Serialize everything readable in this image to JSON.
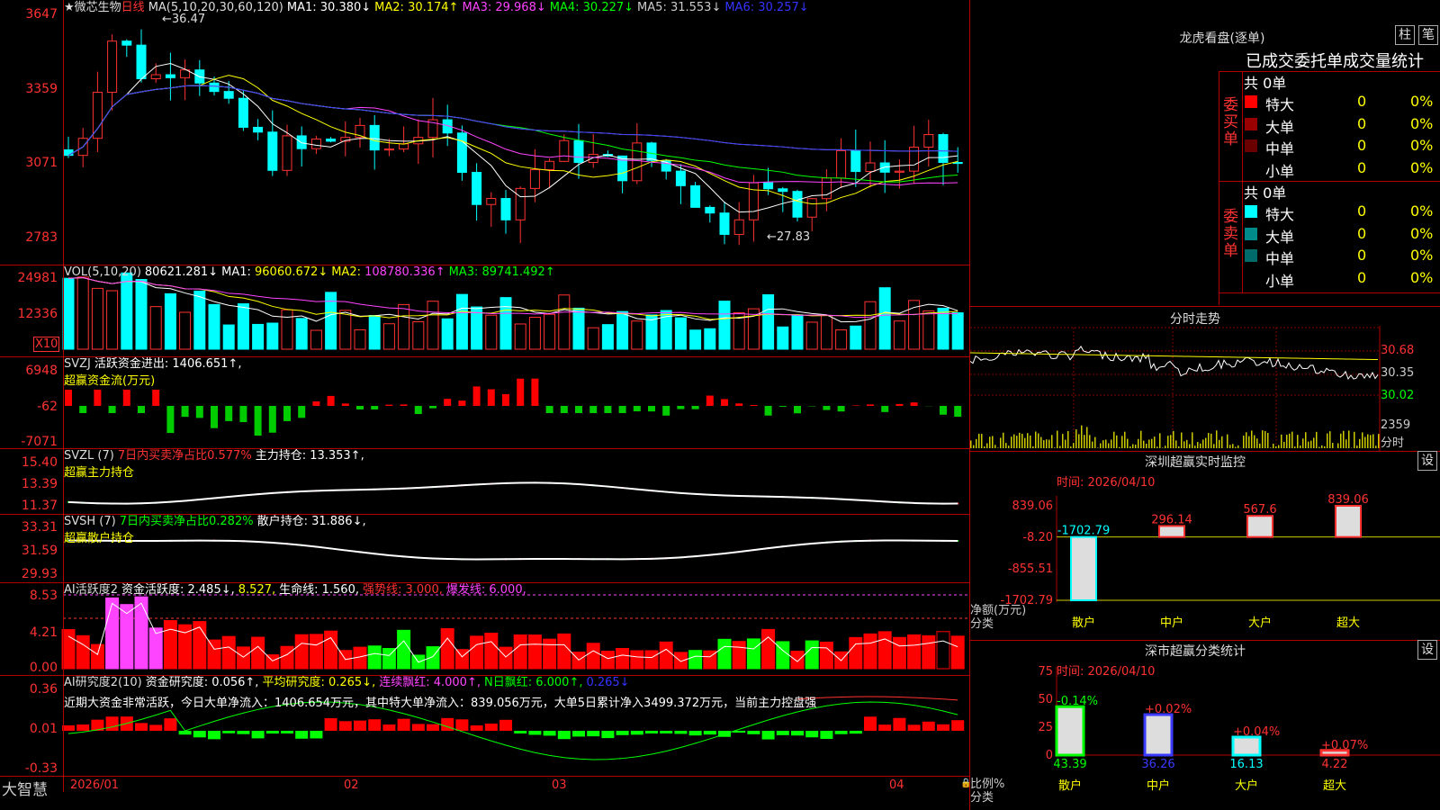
{
  "colors": {
    "up": "#ff3232",
    "down": "#00ffff",
    "ma1": "#ffffff",
    "ma2": "#ffff00",
    "ma3": "#ff44ff",
    "ma4": "#00ff00",
    "ma5": "#c8c8c8",
    "ma6": "#3a3aff"
  },
  "price": {
    "title": "微芯生物",
    "period": "日线",
    "ma_label": "MA(5,10,20,30,60,120)",
    "ma": [
      {
        "name": "MA1",
        "value": "30.380↓"
      },
      {
        "name": "MA2",
        "value": "30.174↑"
      },
      {
        "name": "MA3",
        "value": "29.968↓"
      },
      {
        "name": "MA4",
        "value": "30.227↓"
      },
      {
        "name": "MA5",
        "value": "31.553↓"
      },
      {
        "name": "MA6",
        "value": "30.257↓"
      }
    ],
    "yticks": [
      "3647",
      "3359",
      "3071",
      "2783"
    ],
    "high_label": "36.47",
    "low_label": "27.83"
  },
  "volume": {
    "label": "VOL(5,10,20)",
    "value": "80621.281↓",
    "ma1": "96060.672↓",
    "ma2": "108780.336↑",
    "ma3": "89741.492↑",
    "yticks": [
      "24981",
      "12336"
    ],
    "unit": "X10"
  },
  "svzj": {
    "label": "SVZJ",
    "text1": "活跃资金进出: 1406.651↑,",
    "text2": "超赢资金流(万元)",
    "yticks": [
      "6948",
      "-62",
      "-7071"
    ]
  },
  "svzl": {
    "label": "SVZL (7)",
    "text1": "7日内买卖净占比0.577%",
    "text2": "主力持仓: 13.353↑,",
    "text3": "超赢主力持仓",
    "yticks": [
      "15.40",
      "13.39",
      "11.37"
    ]
  },
  "svsh": {
    "label": "SVSH (7)",
    "text1": "7日内买卖净占比0.282%",
    "text2": "散户持仓: 31.886↓,",
    "text3": "超赢散户持仓",
    "yticks": [
      "33.31",
      "31.59",
      "29.93"
    ]
  },
  "ai1": {
    "label": "AI活跃度2",
    "t1": "资金活跃度: 2.485↓,",
    "t2": "8.527,",
    "t3": "生命线: 1.560,",
    "t4": "强势线: 3.000,",
    "t5": "爆发线: 6.000,",
    "yticks": [
      "8.53",
      "4.21",
      "0.00"
    ]
  },
  "ai2": {
    "label": "AI研究度2(10)",
    "t1": "资金研究度: 0.056↑,",
    "t2": "平均研究度: 0.265↓,",
    "t3": "连续飘红: 4.000↑,",
    "t4": "N日飘红: 6.000↑,",
    "t5": "0.265↓",
    "summary": "近期大资金非常活跃，今日大单净流入：1406.654万元，其中特大单净流入：839.056万元，大单5日累计净入3499.372万元，当前主力控盘强",
    "yticks": [
      "0.36",
      "0.01",
      "-0.33"
    ]
  },
  "xaxis": {
    "labels": [
      "2026/01",
      "02",
      "03",
      "04"
    ],
    "brand": "大智慧"
  },
  "rank": {
    "title": "龙虎看盘(逐单)",
    "btn1": "柱",
    "btn2": "笔",
    "header": "已成交委托单成交量统计",
    "buy": {
      "label": "委买单",
      "total": "共 0单",
      "rows": [
        {
          "name": "特大",
          "val": "0",
          "pct": "0%",
          "color": "#ff0000"
        },
        {
          "name": "大单",
          "val": "0",
          "pct": "0%",
          "color": "#9a0000"
        },
        {
          "name": "中单",
          "val": "0",
          "pct": "0%",
          "color": "#6a0000"
        },
        {
          "name": "小单",
          "val": "0",
          "pct": "0%",
          "color": "#000000"
        }
      ]
    },
    "sell": {
      "label": "委卖单",
      "total": "共 0单",
      "rows": [
        {
          "name": "特大",
          "val": "0",
          "pct": "0%",
          "color": "#00ffff"
        },
        {
          "name": "大单",
          "val": "0",
          "pct": "0%",
          "color": "#008a8a"
        },
        {
          "name": "中单",
          "val": "0",
          "pct": "0%",
          "color": "#006a6a"
        },
        {
          "name": "小单",
          "val": "0",
          "pct": "0%",
          "color": "#000000"
        }
      ]
    }
  },
  "intraday": {
    "title": "分时走势",
    "yticks": [
      "30.68",
      "30.35",
      "30.02"
    ],
    "vol": "2359",
    "vol_unit": "分时"
  },
  "monitor": {
    "title": "深圳超赢实时监控",
    "btn": "设",
    "time": "时间: 2026/04/10",
    "yticks": [
      "839.06",
      "-8.20",
      "-855.51",
      "-1702.79"
    ],
    "ylabel": "净额(万元)",
    "xlabel": "分类",
    "bars": [
      {
        "cat": "散户",
        "value": -1702.79,
        "label": "-1702.79",
        "color": "#00ffff"
      },
      {
        "cat": "中户",
        "value": 296.14,
        "label": "296.14",
        "color": "#ff3232"
      },
      {
        "cat": "大户",
        "value": 567.6,
        "label": "567.6",
        "color": "#ff3232"
      },
      {
        "cat": "超大",
        "value": 839.06,
        "label": "839.06",
        "color": "#ff3232"
      }
    ]
  },
  "classify": {
    "title": "深市超赢分类统计",
    "btn": "设",
    "time": "时间: 2026/04/10",
    "yticks": [
      "75",
      "50",
      "25",
      "0"
    ],
    "ylabel": "比例%",
    "xlabel": "分类",
    "bars": [
      {
        "cat": "散户",
        "value": 43.39,
        "label": "43.39",
        "change": "-0.14%",
        "color": "#00ff00",
        "chg_color": "#00ff00"
      },
      {
        "cat": "中户",
        "value": 36.26,
        "label": "36.26",
        "change": "+0.02%",
        "color": "#3a3aff",
        "chg_color": "#ff3232"
      },
      {
        "cat": "大户",
        "value": 16.13,
        "label": "16.13",
        "change": "+0.04%",
        "color": "#00ffff",
        "chg_color": "#ff3232"
      },
      {
        "cat": "超大",
        "value": 4.22,
        "label": "4.22",
        "change": "+0.07%",
        "color": "#ff3232",
        "chg_color": "#ff3232"
      }
    ]
  }
}
